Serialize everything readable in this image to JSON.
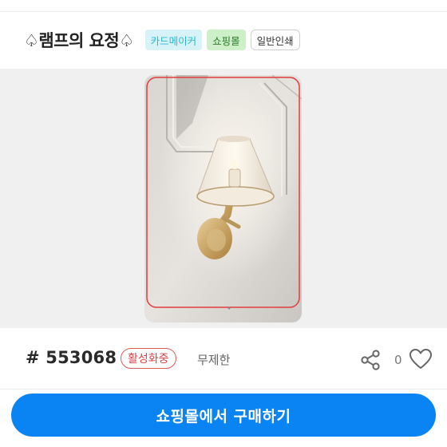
{
  "header": {
    "title": "♤램프의 요정♤",
    "tags": {
      "card_maker": "카드메이커",
      "shopping_mall": "쇼핑몰",
      "general_print": "일반인쇄"
    }
  },
  "product": {
    "id": "# 553068",
    "status": "활성화중",
    "limit": "무제한",
    "like_count": "0"
  },
  "actions": {
    "buy_label": "쇼핑몰에서 구매하기"
  },
  "colors": {
    "primary": "#0a84f2",
    "status_red": "#d64545",
    "tag_card_bg": "#d8f3f8",
    "tag_shop_bg": "#cdf0c9"
  },
  "icons": {
    "share": "share-icon",
    "like": "heart-outline-icon"
  }
}
